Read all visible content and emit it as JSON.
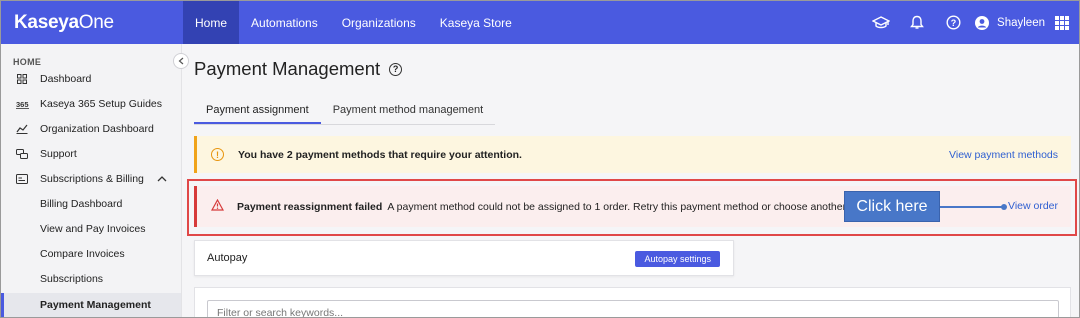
{
  "brand": {
    "name_bold": "Kaseya",
    "name_light": "One"
  },
  "nav": {
    "items": [
      "Home",
      "Automations",
      "Organizations",
      "Kaseya Store"
    ]
  },
  "user": {
    "name": "Shayleen"
  },
  "sidebar": {
    "section": "HOME",
    "items": [
      {
        "label": "Dashboard",
        "icon": "grid-icon"
      },
      {
        "label": "Kaseya 365 Setup Guides",
        "icon": "k365-icon"
      },
      {
        "label": "Organization Dashboard",
        "icon": "chart-icon"
      },
      {
        "label": "Support",
        "icon": "support-icon"
      },
      {
        "label": "Subscriptions & Billing",
        "icon": "billing-icon"
      }
    ],
    "subitems": [
      "Billing Dashboard",
      "View and Pay Invoices",
      "Compare Invoices",
      "Subscriptions",
      "Payment Management"
    ]
  },
  "page": {
    "title": "Payment Management",
    "tabs": [
      "Payment assignment",
      "Payment method management"
    ]
  },
  "warning": {
    "message": "You have 2 payment methods that require your attention.",
    "link": "View payment methods"
  },
  "error": {
    "title": "Payment reassignment failed",
    "message": "A payment method could not be assigned to 1 order. Retry this payment method or choose another.",
    "link": "View order"
  },
  "callout": {
    "label": "Click here"
  },
  "autopay": {
    "title": "Autopay",
    "button": "Autopay settings"
  },
  "filter": {
    "placeholder": "Filter or search keywords..."
  },
  "colors": {
    "primary": "#4a5ae0",
    "warning": "#f0a31a",
    "error": "#d63a3a",
    "link": "#2f5fd1"
  }
}
